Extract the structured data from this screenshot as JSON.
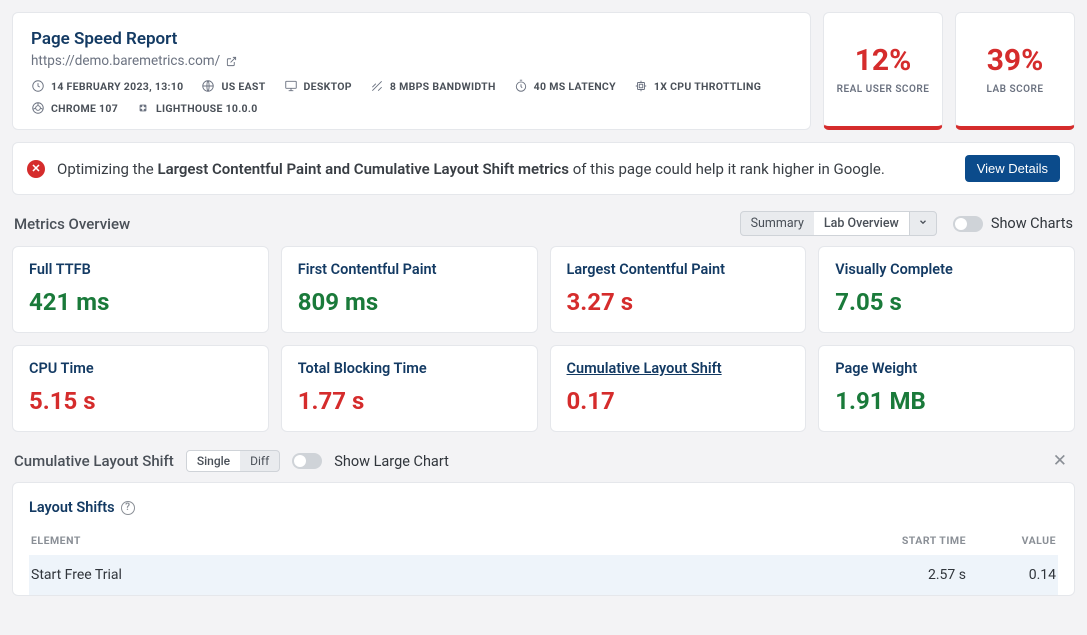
{
  "header": {
    "title": "Page Speed Report",
    "url": "https://demo.baremetrics.com/",
    "meta": [
      "14 FEBRUARY 2023, 13:10",
      "US EAST",
      "DESKTOP",
      "8 MBPS BANDWIDTH",
      "40 MS LATENCY",
      "1X CPU THROTTLING",
      "CHROME 107",
      "LIGHTHOUSE 10.0.0"
    ]
  },
  "scores": {
    "real_user": {
      "value": "12%",
      "label": "REAL USER SCORE"
    },
    "lab": {
      "value": "39%",
      "label": "LAB SCORE"
    }
  },
  "alert": {
    "pre": "Optimizing the ",
    "bold": "Largest Contentful Paint and Cumulative Layout Shift metrics",
    "post": " of this page could help it rank higher in Google.",
    "button": "View Details"
  },
  "metrics_overview": {
    "title": "Metrics Overview",
    "seg_summary": "Summary",
    "seg_lab": "Lab Overview",
    "toggle_label": "Show Charts"
  },
  "metrics": [
    {
      "label": "Full TTFB",
      "value": "421 ms",
      "status": "good"
    },
    {
      "label": "First Contentful Paint",
      "value": "809 ms",
      "status": "good"
    },
    {
      "label": "Largest Contentful Paint",
      "value": "3.27 s",
      "status": "bad"
    },
    {
      "label": "Visually Complete",
      "value": "7.05 s",
      "status": "good"
    },
    {
      "label": "CPU Time",
      "value": "5.15 s",
      "status": "bad"
    },
    {
      "label": "Total Blocking Time",
      "value": "1.77 s",
      "status": "bad"
    },
    {
      "label": "Cumulative Layout Shift",
      "value": "0.17",
      "status": "bad",
      "underline": true
    },
    {
      "label": "Page Weight",
      "value": "1.91 MB",
      "status": "good"
    }
  ],
  "cls_section": {
    "title": "Cumulative Layout Shift",
    "seg_single": "Single",
    "seg_diff": "Diff",
    "toggle_label": "Show Large Chart",
    "panel_title": "Layout Shifts",
    "col_element": "ELEMENT",
    "col_start": "START TIME",
    "col_value": "VALUE",
    "rows": [
      {
        "element": "Start Free Trial",
        "start": "2.57 s",
        "value": "0.14"
      }
    ]
  }
}
